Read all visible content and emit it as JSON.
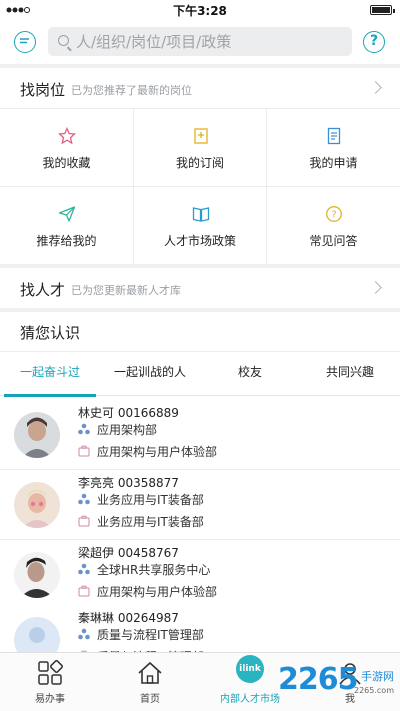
{
  "status_bar": {
    "carrier": "",
    "time": "下午3:28"
  },
  "header": {
    "search_placeholder": "人/组织/岗位/项目/政策",
    "left_icon": "chat-bubble-icon",
    "right_icon": "help-icon",
    "help_glyph": "?"
  },
  "find_job": {
    "title": "找岗位",
    "subtitle": "已为您推荐了最新的岗位",
    "grid": [
      {
        "label": "我的收藏",
        "icon": "star-icon"
      },
      {
        "label": "我的订阅",
        "icon": "bookmark-icon"
      },
      {
        "label": "我的申请",
        "icon": "document-icon"
      },
      {
        "label": "推荐给我的",
        "icon": "send-icon"
      },
      {
        "label": "人才市场政策",
        "icon": "book-icon"
      },
      {
        "label": "常见问答",
        "icon": "question-icon"
      }
    ]
  },
  "find_talent": {
    "title": "找人才",
    "subtitle": "已为您更新最新人才库"
  },
  "guess": {
    "title": "猜您认识",
    "tabs": [
      {
        "label": "一起奋斗过",
        "active": true
      },
      {
        "label": "一起训战的人",
        "active": false
      },
      {
        "label": "校友",
        "active": false
      },
      {
        "label": "共同兴趣",
        "active": false
      }
    ],
    "people": [
      {
        "name": "林史可 00166889",
        "dept": "应用架构部",
        "org": "应用架构与用户体验部"
      },
      {
        "name": "李亮亮 00358877",
        "dept": "业务应用与IT装备部",
        "org": "业务应用与IT装备部"
      },
      {
        "name": "梁超伊 00458767",
        "dept": "全球HR共享服务中心",
        "org": "应用架构与用户体验部"
      },
      {
        "name": "秦琳琳 00264987",
        "dept": "质量与流程IT管理部",
        "org": "质量与流程IT管理部"
      }
    ]
  },
  "bottom_nav": [
    {
      "label": "易办事",
      "icon": "apps-grid-icon",
      "active": false
    },
    {
      "label": "首页",
      "icon": "home-icon",
      "active": false
    },
    {
      "label": "内部人才市场",
      "icon": "ilink-logo-icon",
      "active": true,
      "logo_text": "ilink"
    },
    {
      "label": "我",
      "icon": "person-icon",
      "active": false
    }
  ],
  "watermark": {
    "number": "2265",
    "site": "手游网",
    "url": "2265.com"
  },
  "colors": {
    "accent": "#1aa3b8",
    "star": "#e0607e",
    "bookmark": "#e0b020",
    "doc": "#3a8fd6",
    "send": "#2bb5a0",
    "book": "#2a9ad0",
    "question": "#e2b32a"
  }
}
